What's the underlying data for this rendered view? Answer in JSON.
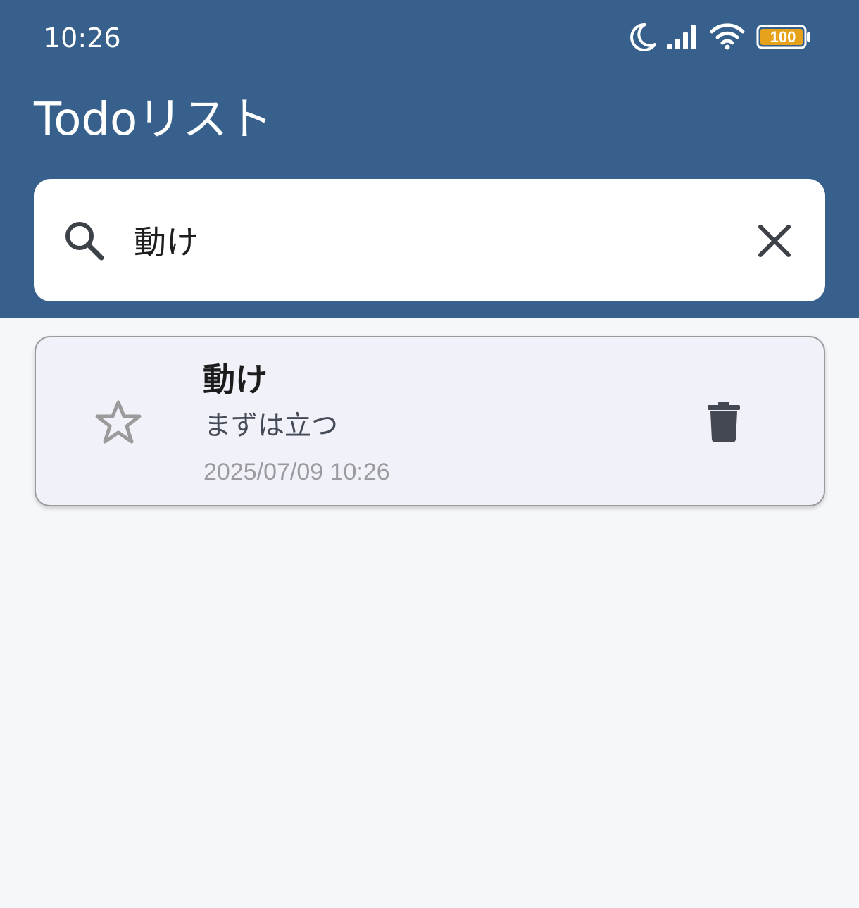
{
  "status_bar": {
    "time": "10:26",
    "icons": [
      "moon-icon",
      "signal-icon",
      "wifi-icon",
      "battery-icon"
    ],
    "battery_level": "100"
  },
  "app_bar": {
    "title": "Todoリスト",
    "background_color": "#37618c"
  },
  "search": {
    "value": "動け",
    "icon": "search-icon",
    "clear_icon": "close-icon"
  },
  "todos": [
    {
      "title": "動け",
      "description": "まずは立つ",
      "date": "2025/07/09 10:26",
      "starred": false,
      "star_icon": "star-outline-icon",
      "delete_icon": "trash-icon"
    }
  ],
  "colors": {
    "accent": "#37618c",
    "card_background": "#f0f1f9",
    "page_background": "#f6f7fb",
    "battery": "#e6a21a"
  }
}
